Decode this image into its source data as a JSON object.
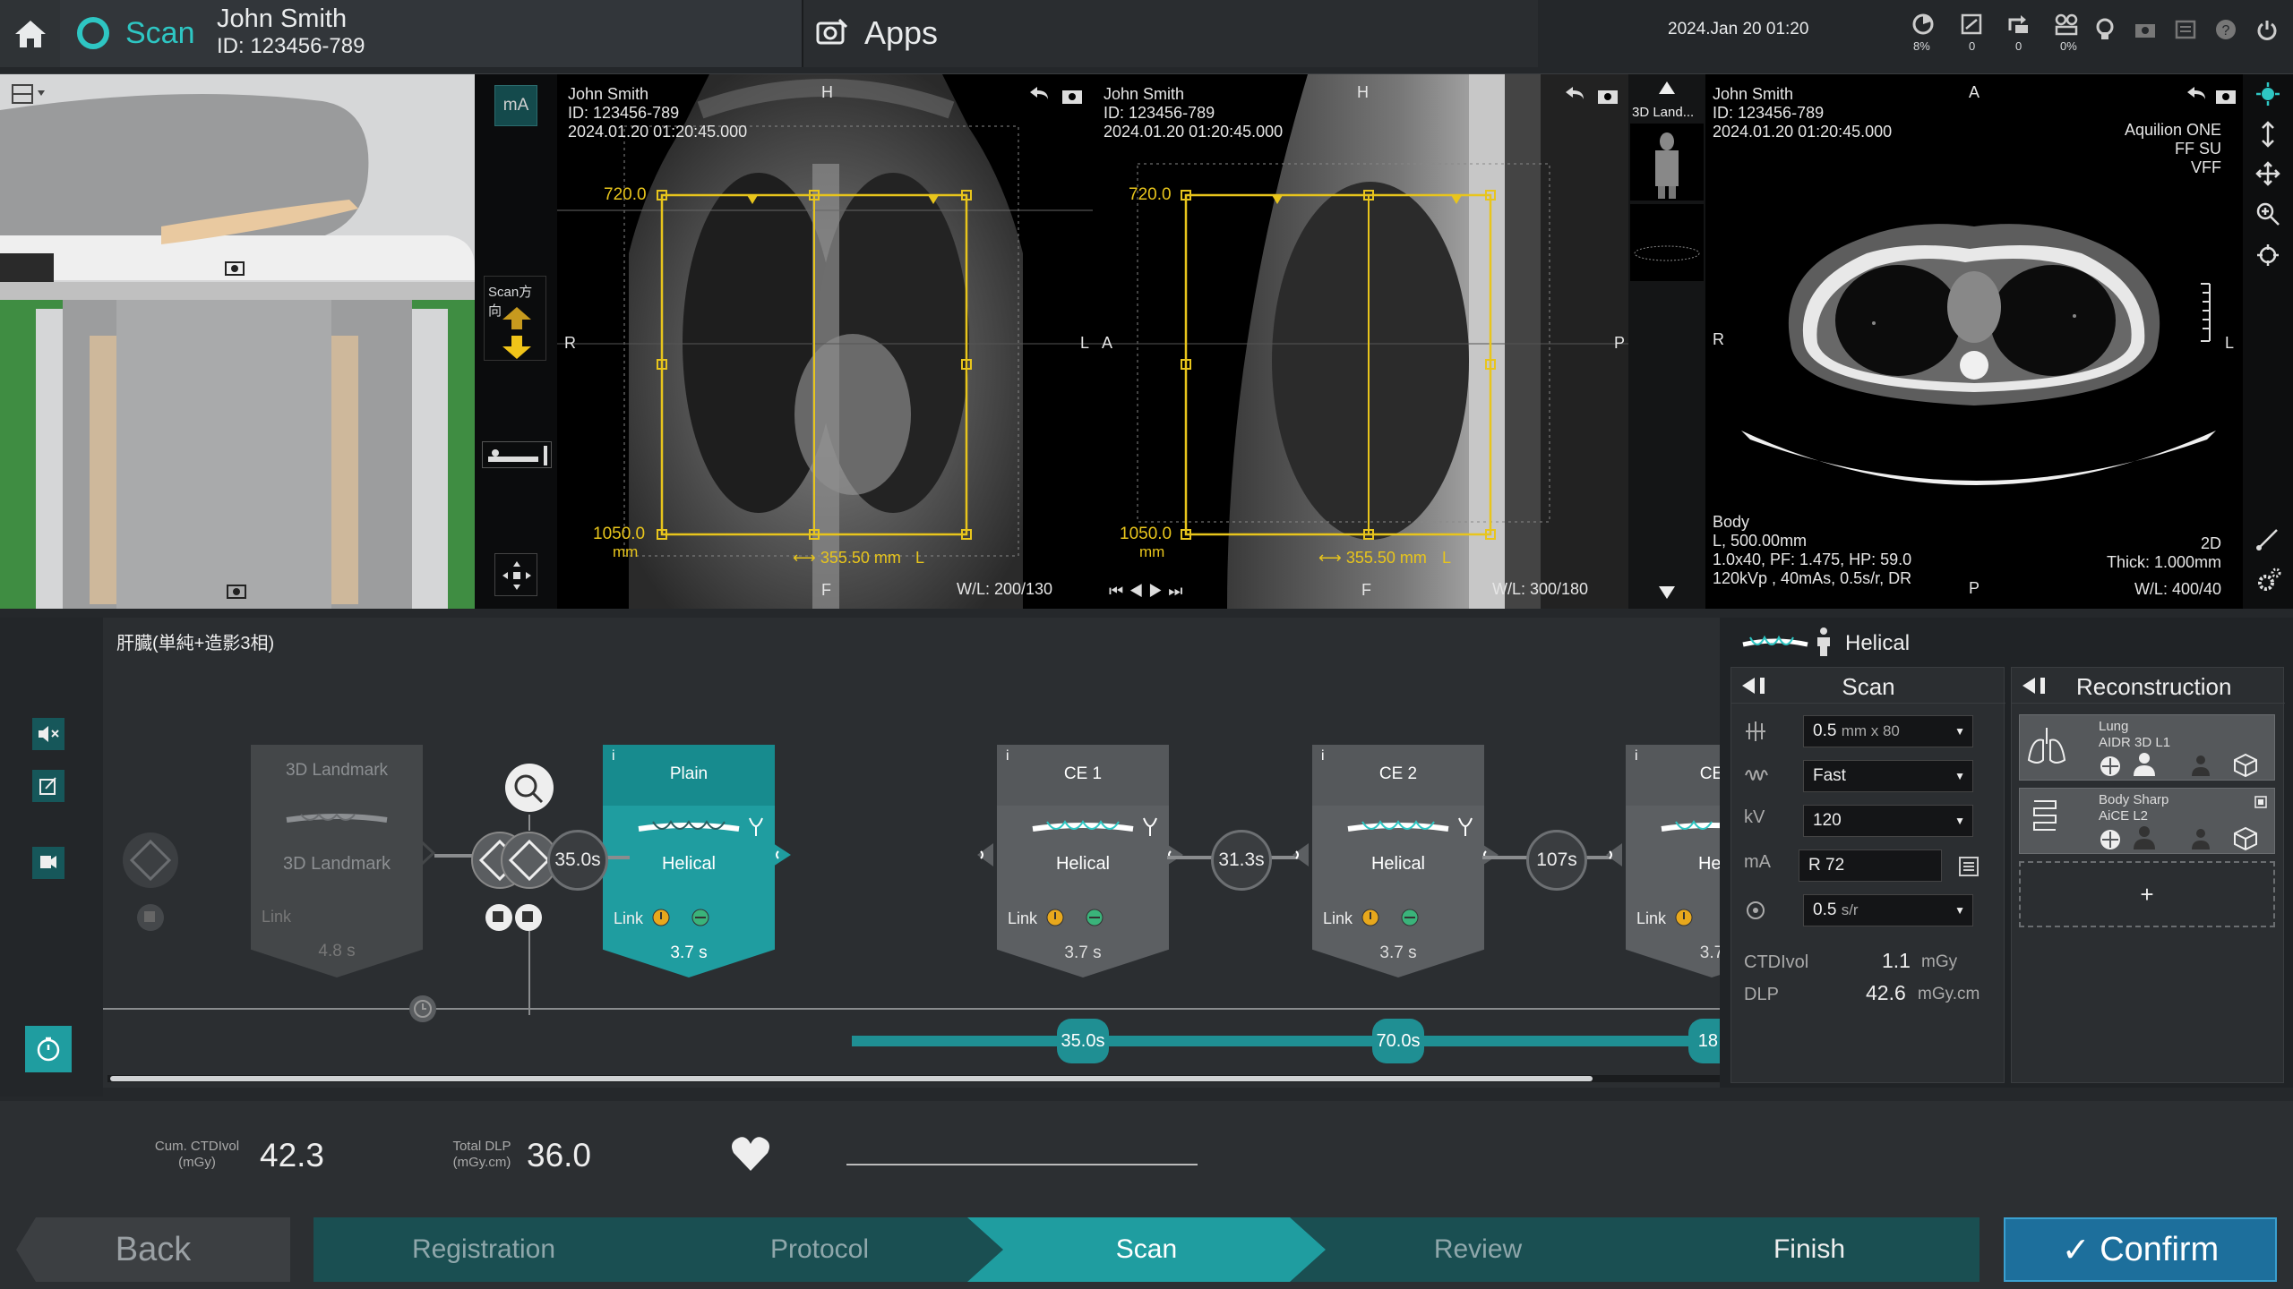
{
  "header": {
    "app_title": "Scan",
    "patient_name": "John Smith",
    "patient_id": "ID: 123456-789",
    "apps_label": "Apps",
    "datetime": "2024.Jan 20 01:20",
    "status_values": [
      "8%",
      "0",
      "0",
      "0%"
    ]
  },
  "left_panel": {
    "ma_label": "mA",
    "scan_direction_label": "Scan方向"
  },
  "viewer_frontal": {
    "name": "John Smith",
    "id": "ID: 123456-789",
    "date": "2024.01.20 01:20:45.000",
    "top": "H",
    "bottom": "F",
    "left": "R",
    "right": "L",
    "top_pos": "720.0",
    "bottom_pos": "1050.0",
    "unit": "mm",
    "width": "355.50 mm",
    "width_suffix": "L",
    "wl": "W/L: 200/130"
  },
  "viewer_lateral": {
    "name": "John Smith",
    "id": "ID: 123456-789",
    "date": "2024.01.20 01:20:45.000",
    "top": "H",
    "bottom": "F",
    "left": "A",
    "right": "P",
    "top_pos": "720.0",
    "bottom_pos": "1050.0",
    "unit": "mm",
    "width": "355.50 mm",
    "width_suffix": "L",
    "wl": "W/L: 300/180"
  },
  "landmark_strip": {
    "label": "3D Land..."
  },
  "viewer_axial": {
    "name": "John Smith",
    "id": "ID: 123456-789",
    "date": "2024.01.20 01:20:45.000",
    "top": "A",
    "bottom": "P",
    "left": "R",
    "right": "L",
    "model": "Aquilion ONE",
    "pos": "FF SU",
    "vff": "VFF",
    "body": "Body",
    "l": "L, 500.00mm",
    "params1": "1.0x40, PF: 1.475, HP: 59.0",
    "params2": "120kVp , 40mAs, 0.5s/r, DR",
    "dim": "2D",
    "thick": "Thick: 1.000mm",
    "wl": "W/L: 400/40"
  },
  "protocol": {
    "name": "肝臓(単純+造影3相)",
    "steps": [
      {
        "title": "3D Landmark",
        "mode": "3D Landmark",
        "link": "Link",
        "time": "4.8 s"
      },
      {
        "title": "Plain",
        "mode": "Helical",
        "link": "Link",
        "time": "3.7 s"
      },
      {
        "title": "CE 1",
        "mode": "Helical",
        "link": "Link",
        "time": "3.7 s"
      },
      {
        "title": "CE 2",
        "mode": "Helical",
        "link": "Link",
        "time": "3.7 s"
      },
      {
        "title": "CE",
        "mode": "Hel",
        "link": "Link",
        "time": "3.7"
      }
    ],
    "delays": [
      "35.0s",
      "31.3s",
      "107s"
    ],
    "timeline_marks": [
      "35.0s",
      "70.0s",
      "18"
    ]
  },
  "scan_panel": {
    "mode": "Helical",
    "scan_title": "Scan",
    "recon_title": "Reconstruction",
    "params": [
      {
        "icon": "collimation-icon",
        "value": "0.5",
        "unit": "mm x 80"
      },
      {
        "icon": "speed-icon",
        "value": "Fast",
        "unit": ""
      },
      {
        "icon": "kv-label",
        "label": "kV",
        "value": "120",
        "unit": ""
      },
      {
        "icon": "ma-label",
        "label": "mA",
        "value": "R 72",
        "unit": ""
      },
      {
        "icon": "rotation-icon",
        "value": "0.5",
        "unit": "s/r"
      }
    ],
    "ctdivol_label": "CTDIvol",
    "ctdivol_value": "1.1",
    "ctdivol_unit": "mGy",
    "dlp_label": "DLP",
    "dlp_value": "42.6",
    "dlp_unit": "mGy.cm",
    "recons": [
      {
        "name": "Lung",
        "sub": "AIDR 3D L1"
      },
      {
        "name": "Body Sharp",
        "sub": "AiCE L2"
      }
    ],
    "add_label": "+"
  },
  "footer": {
    "cum_label": "Cum. CTDIvol",
    "cum_unit": "(mGy)",
    "cum_value": "42.3",
    "dlp_label": "Total DLP",
    "dlp_unit": "(mGy.cm)",
    "dlp_value": "36.0",
    "back": "Back",
    "steps": [
      "Registration",
      "Protocol",
      "Scan",
      "Review",
      "Finish"
    ],
    "confirm": "Confirm"
  },
  "colors": {
    "teal": "#1f9da0",
    "yellow": "#e8c51c",
    "accent": "#2ec6c3"
  }
}
